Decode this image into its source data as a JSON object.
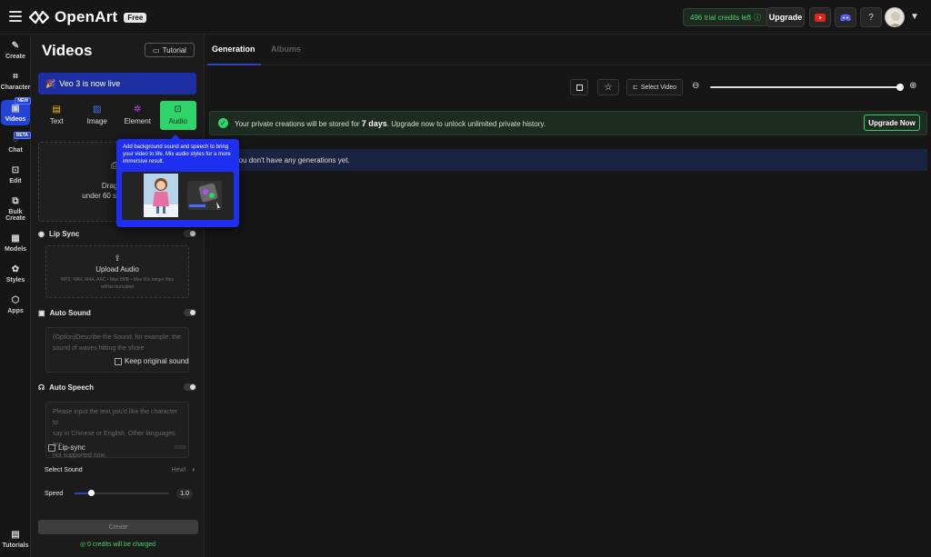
{
  "app": {
    "brand": "OpenArt",
    "plan_badge": "Free",
    "credits": "496 trial credits left",
    "upgrade_label": "Upgrade"
  },
  "rail": {
    "items": [
      {
        "label": "Create",
        "icon": "create-icon"
      },
      {
        "label": "Character",
        "icon": "character-icon"
      },
      {
        "label": "Videos",
        "icon": "videos-icon",
        "badge": "NEW"
      },
      {
        "label": "Chat",
        "icon": "chat-icon",
        "badge": "BETA"
      },
      {
        "label": "Edit",
        "icon": "edit-icon"
      },
      {
        "label": "Bulk",
        "icon": "bulk-create-icon"
      },
      {
        "label": "Create",
        "icon": "bulk-create-icon"
      },
      {
        "label": "Models",
        "icon": "models-icon"
      },
      {
        "label": "Styles",
        "icon": "styles-icon"
      },
      {
        "label": "Apps",
        "icon": "apps-icon"
      },
      {
        "label": "Tutorials",
        "icon": "tutorials-icon"
      }
    ]
  },
  "panel": {
    "title": "Videos",
    "tutorial_label": "Tutorial",
    "banner": "Veo 3 is now live",
    "tabs": [
      {
        "label": "Text",
        "icon": "text-icon"
      },
      {
        "label": "Image",
        "icon": "image-icon"
      },
      {
        "label": "Element",
        "icon": "element-icon"
      },
      {
        "label": "Audio",
        "icon": "audio-icon"
      }
    ],
    "active_tab": "Audio",
    "dropzone_line1": "Drag & dr",
    "dropzone_line2": "under 60 seconds or f",
    "lip_sync_label": "Lip Sync",
    "upload_audio_label": "Upload Audio",
    "upload_audio_hint1": "MP3, WAV, M4A, AAC • Max 5MB • Max 60s longer files",
    "upload_audio_hint2": "will be truncated",
    "auto_sound_label": "Auto Sound",
    "auto_sound_placeholder1": "(Option)Describe the Sound, for example: the",
    "auto_sound_placeholder2": "sound of waves hitting the shore",
    "keep_original_label": "Keep original sound",
    "auto_speech_label": "Auto Speech",
    "speech_placeholder1": "Please input the text you'd like the character to",
    "speech_placeholder2": "say in Chinese or English. Other languages are",
    "speech_placeholder3": "not supported now.",
    "lip_sync_check_label": "Lip-sync",
    "char_count": "0/300",
    "select_sound_label": "Select Sound",
    "select_sound_value": "Hewl",
    "speed_label": "Speed",
    "speed_value": "1.0",
    "speed_level": 0.18,
    "create_label": "Create",
    "charge_note": "0 credits will be charged"
  },
  "main": {
    "tabs": [
      "Generation",
      "Albums"
    ],
    "active_tab": "Generation",
    "select_video_label": "Select Video",
    "notice_pre": "Your private creations will be stored for",
    "notice_days": "7 days",
    "notice_post": ". Upgrade now to unlock unlimited private history.",
    "upgrade_now_label": "Upgrade Now",
    "empty_text": "You don't have any generations yet."
  },
  "popup": {
    "text": "Add background sound and speech to bring your video to life. Mix audio styles for a more immersive result."
  },
  "colors": {
    "accent_blue": "#2343d8",
    "active_tab_green": "#2ed36a",
    "credits_green": "#4fd36a"
  }
}
